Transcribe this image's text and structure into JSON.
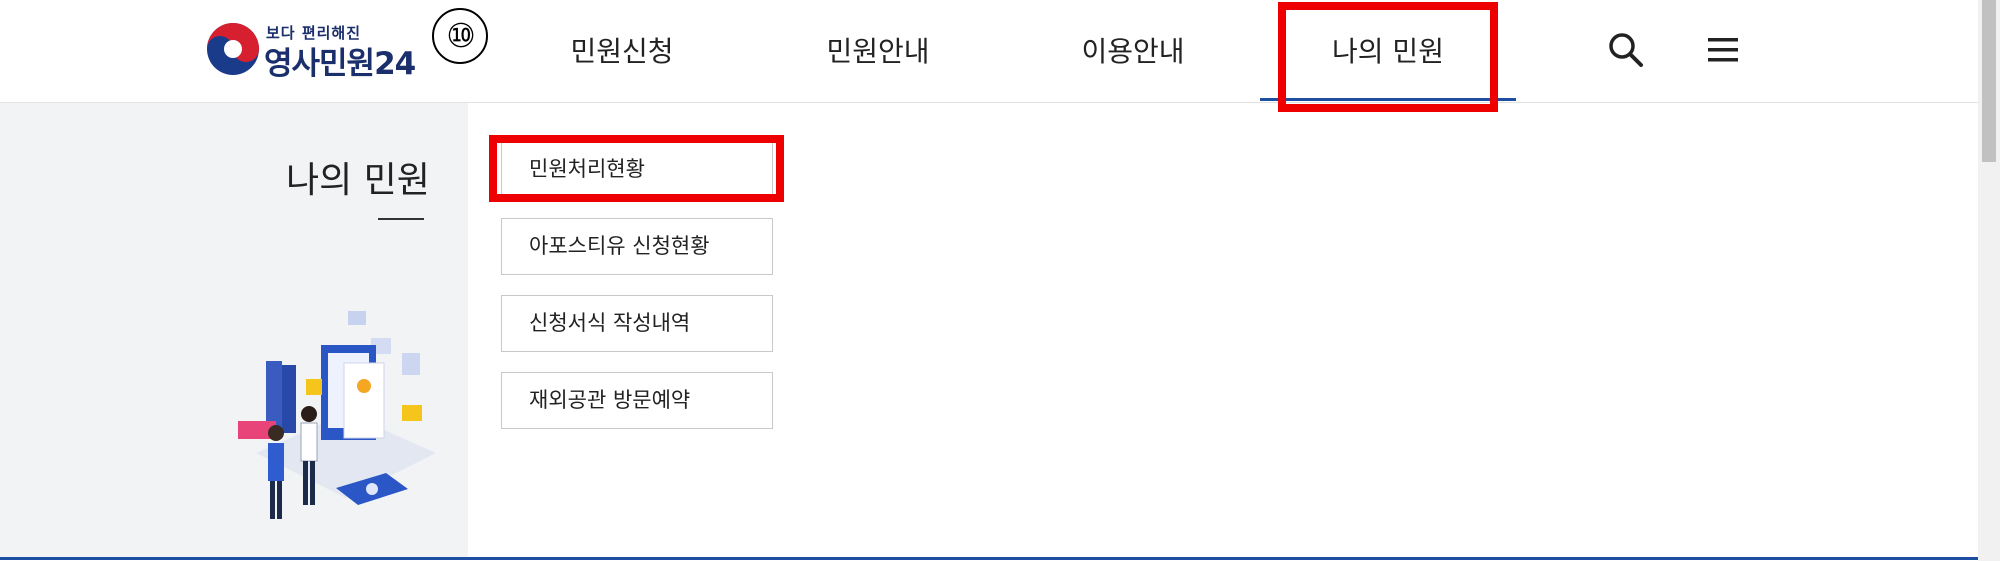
{
  "logo": {
    "slogan": "보다 편리해진",
    "name": "영사민원24"
  },
  "step_badge": "⑩",
  "nav": {
    "items": [
      {
        "label": "민원신청"
      },
      {
        "label": "민원안내"
      },
      {
        "label": "이용안내"
      },
      {
        "label": "나의 민원",
        "active": true
      }
    ],
    "search_icon": "search-icon",
    "menu_icon": "hamburger-menu-icon"
  },
  "sidebar": {
    "title": "나의 민원"
  },
  "submenu": {
    "items": [
      {
        "label": "민원처리현황",
        "highlighted": true
      },
      {
        "label": "아포스티유 신청현황"
      },
      {
        "label": "신청서식 작성내역"
      },
      {
        "label": "재외공관 방문예약"
      }
    ]
  },
  "colors": {
    "accent": "#1d4ea1",
    "highlight": "#ee0000",
    "sidebar_bg": "#f2f3f5"
  }
}
